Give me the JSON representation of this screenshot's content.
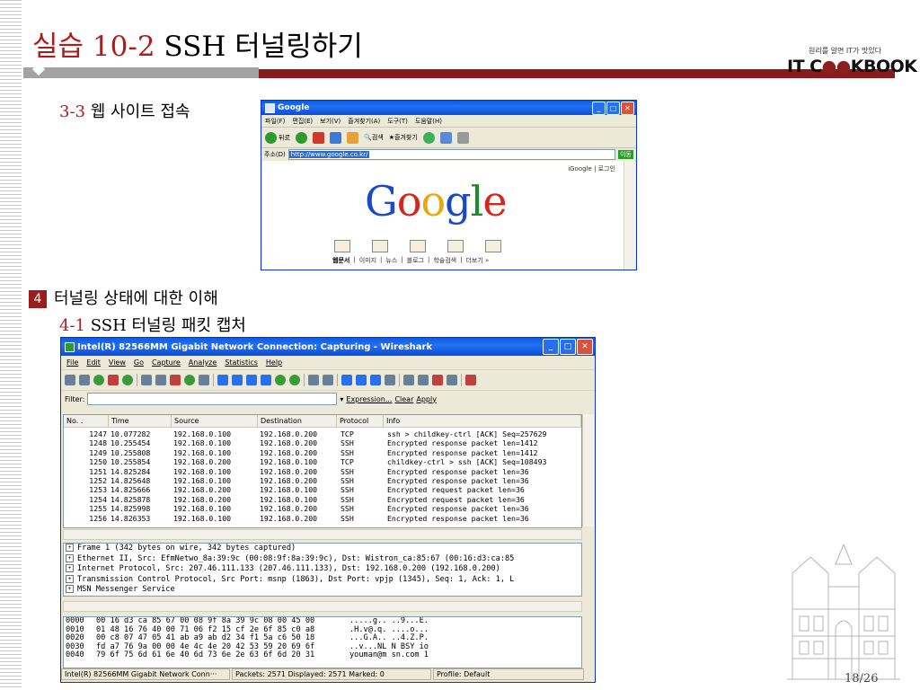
{
  "slide": {
    "title_num": "실습 10-2",
    "title_text": "SSH 터널링하기",
    "logo_tagline": "원리를 알면 IT가 맛있다",
    "logo_prefix": "IT C",
    "logo_oo": "●●",
    "logo_suffix": "KBOOK",
    "sub1_num": "3-3",
    "sub1_text": "웹 사이트 접속",
    "sec4_num": "4",
    "sec4_text": "터널링 상태에 대한 이해",
    "sub41_num": "4-1",
    "sub41_text": "SSH 터널링 패킷 캡처",
    "page": "18/26"
  },
  "ie": {
    "title": "Google",
    "menu": [
      "파일(F)",
      "편집(E)",
      "보기(V)",
      "즐겨찾기(A)",
      "도구(T)",
      "도움말(H)"
    ],
    "toolbar": [
      "뒤로",
      "검색",
      "즐겨찾기"
    ],
    "address_label": "주소(D)",
    "address": "http://www.google.co.kr/",
    "go_label": "이동",
    "top_links": "iGoogle | 로그인",
    "logo_letters": [
      "G",
      "o",
      "o",
      "g",
      "l",
      "e"
    ],
    "links": [
      "웹문서",
      "이미지",
      "뉴스",
      "블로그",
      "학술검색",
      "더보기 »"
    ]
  },
  "ws": {
    "title": "Intel(R) 82566MM Gigabit Network Connection: Capturing - Wireshark",
    "menu": [
      "File",
      "Edit",
      "View",
      "Go",
      "Capture",
      "Analyze",
      "Statistics",
      "Help"
    ],
    "filter_label": "Filter:",
    "expression": "Expression...",
    "clear": "Clear",
    "apply": "Apply",
    "columns": [
      "No. .",
      "Time",
      "Source",
      "Destination",
      "Protocol",
      "Info"
    ],
    "packets": [
      [
        "1247",
        "10.077282",
        "192.168.0.100",
        "192.168.0.200",
        "TCP",
        "ssh > childkey-ctrl [ACK] Seq=257629"
      ],
      [
        "1248",
        "10.255454",
        "192.168.0.100",
        "192.168.0.200",
        "SSH",
        "Encrypted response packet len=1412"
      ],
      [
        "1249",
        "10.255808",
        "192.168.0.100",
        "192.168.0.200",
        "SSH",
        "Encrypted response packet len=1412"
      ],
      [
        "1250",
        "10.255854",
        "192.168.0.200",
        "192.168.0.100",
        "TCP",
        "childkey-ctrl > ssh [ACK] Seq=108493"
      ],
      [
        "1251",
        "14.825284",
        "192.168.0.100",
        "192.168.0.200",
        "SSH",
        "Encrypted response packet len=36"
      ],
      [
        "1252",
        "14.825648",
        "192.168.0.100",
        "192.168.0.200",
        "SSH",
        "Encrypted response packet len=36"
      ],
      [
        "1253",
        "14.825666",
        "192.168.0.200",
        "192.168.0.100",
        "SSH",
        "Encrypted request packet len=36"
      ],
      [
        "1254",
        "14.825878",
        "192.168.0.200",
        "192.168.0.100",
        "SSH",
        "Encrypted request packet len=36"
      ],
      [
        "1255",
        "14.825998",
        "192.168.0.100",
        "192.168.0.200",
        "SSH",
        "Encrypted response packet len=36"
      ],
      [
        "1256",
        "14.826353",
        "192.168.0.100",
        "192.168.0.200",
        "SSH",
        "Encrypted response packet len=36"
      ]
    ],
    "details": [
      "Frame 1 (342 bytes on wire, 342 bytes captured)",
      "Ethernet II, Src: EfmNetwo_8a:39:9c (00:08:9f:8a:39:9c), Dst: Wistron_ca:85:67 (00:16:d3:ca:85",
      "Internet Protocol, Src: 207.46.111.133 (207.46.111.133), Dst: 192.168.0.200 (192.168.0.200)",
      "Transmission Control Protocol, Src Port: msnp (1863), Dst Port: vpjp (1345), Seq: 1, Ack: 1, L",
      "MSN Messenger Service"
    ],
    "hex": [
      [
        "0000",
        "00 16 d3 ca 85 67 00 08  9f 8a 39 9c 08 00 45 00",
        ".....g.. ..9...E."
      ],
      [
        "0010",
        "01 48 16 76 40 00 71 06  f2 15 cf 2e 6f 85 c0 a8",
        ".H.v@.q. ....o..."
      ],
      [
        "0020",
        "00 c8 07 47 05 41 ab a9  ab d2 34 f1 5a c6 50 18",
        "...G.A.. ..4.Z.P."
      ],
      [
        "0030",
        "fd a7 76 9a 00 00 4e 4c  4e 20 42 53 59 20 69 6f",
        "..v...NL N BSY io"
      ],
      [
        "0040",
        "79 6f 75 6d 61 6e 40 6d  73 6e 2e 63 6f 6d 20 31",
        "youman@m sn.com 1"
      ]
    ],
    "status": [
      "Intel(R) 82566MM Gigabit Network Conn···",
      "Packets: 2571 Displayed: 2571 Marked: 0",
      "Profile: Default"
    ]
  }
}
